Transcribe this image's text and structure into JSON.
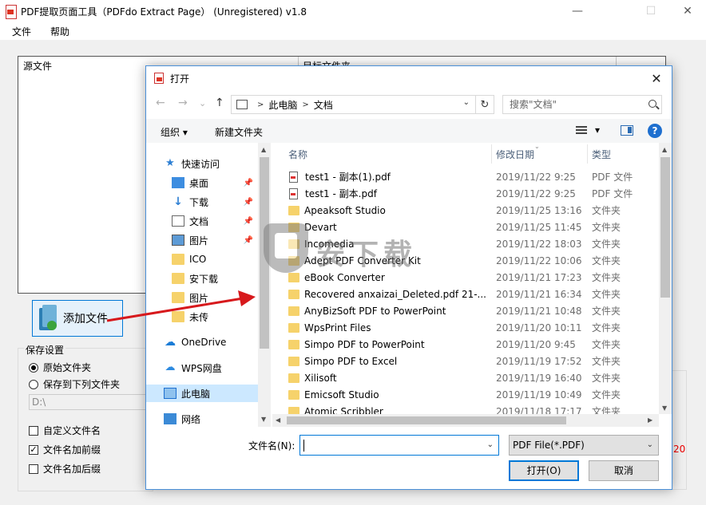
{
  "app": {
    "title": "PDF提取页面工具（PDFdo Extract Page） (Unregistered) v1.8",
    "window_controls": {
      "minimize": "—",
      "maximize": "☐",
      "close": "✕"
    },
    "menu": [
      "文件",
      "帮助"
    ],
    "source_panel": {
      "source_header": "源文件",
      "target_header": "目标文件夹"
    },
    "add_file_label": "添加文件",
    "save_settings": {
      "title": "保存设置",
      "radio_original": "原始文件夹",
      "radio_save_to": "保存到下列文件夹",
      "path_value": "D:\\",
      "check_custom_name": "自定义文件名",
      "check_prefix": "文件名加前缀",
      "check_suffix": "文件名加后缀"
    },
    "red_number": "20"
  },
  "dialog": {
    "title": "打开",
    "close": "✕",
    "nav": {
      "back": "←",
      "forward": "→",
      "recent": "⌄",
      "up": "↑"
    },
    "breadcrumb": [
      "此电脑",
      "文档"
    ],
    "search_placeholder": "搜索\"文档\"",
    "toolbar": {
      "organize": "组织 ▾",
      "new_folder": "新建文件夹",
      "view_dropdown": "▾",
      "help": "?"
    },
    "nav_pane": [
      {
        "label": "快速访问",
        "icon": "star-icon",
        "pinned": false
      },
      {
        "label": "桌面",
        "icon": "desktop-icon",
        "pinned": true
      },
      {
        "label": "下载",
        "icon": "download-icon",
        "pinned": true
      },
      {
        "label": "文档",
        "icon": "document-icon",
        "pinned": true
      },
      {
        "label": "图片",
        "icon": "pictures-icon",
        "pinned": true
      },
      {
        "label": "ICO",
        "icon": "folder-icon",
        "pinned": false
      },
      {
        "label": "安下载",
        "icon": "folder-icon",
        "pinned": false
      },
      {
        "label": "图片",
        "icon": "folder-icon",
        "pinned": false
      },
      {
        "label": "未传",
        "icon": "folder-icon",
        "pinned": false
      },
      {
        "label": "OneDrive",
        "icon": "cloud-icon",
        "pinned": false
      },
      {
        "label": "WPS网盘",
        "icon": "wps-cloud-icon",
        "pinned": false
      },
      {
        "label": "此电脑",
        "icon": "computer-icon",
        "pinned": false,
        "selected": true
      },
      {
        "label": "网络",
        "icon": "network-icon",
        "pinned": false
      }
    ],
    "columns": {
      "name": "名称",
      "date": "修改日期",
      "type": "类型"
    },
    "files": [
      {
        "name": "test1 - 副本(1).pdf",
        "date": "2019/11/22 9:25",
        "type": "PDF 文件",
        "kind": "pdf"
      },
      {
        "name": "test1 - 副本.pdf",
        "date": "2019/11/22 9:25",
        "type": "PDF 文件",
        "kind": "pdf"
      },
      {
        "name": "Apeaksoft Studio",
        "date": "2019/11/25 13:16",
        "type": "文件夹",
        "kind": "folder"
      },
      {
        "name": "Devart",
        "date": "2019/11/25 11:45",
        "type": "文件夹",
        "kind": "folder"
      },
      {
        "name": "Incomedia",
        "date": "2019/11/22 18:03",
        "type": "文件夹",
        "kind": "folder"
      },
      {
        "name": "Adept PDF Converter Kit",
        "date": "2019/11/22 10:06",
        "type": "文件夹",
        "kind": "folder"
      },
      {
        "name": "eBook Converter",
        "date": "2019/11/21 17:23",
        "type": "文件夹",
        "kind": "folder"
      },
      {
        "name": "Recovered anxaizai_Deleted.pdf 21-...",
        "date": "2019/11/21 16:34",
        "type": "文件夹",
        "kind": "folder"
      },
      {
        "name": "AnyBizSoft PDF to PowerPoint",
        "date": "2019/11/21 10:48",
        "type": "文件夹",
        "kind": "folder"
      },
      {
        "name": "WpsPrint Files",
        "date": "2019/11/20 10:11",
        "type": "文件夹",
        "kind": "folder"
      },
      {
        "name": "Simpo PDF to PowerPoint",
        "date": "2019/11/20 9:45",
        "type": "文件夹",
        "kind": "folder"
      },
      {
        "name": "Simpo PDF to Excel",
        "date": "2019/11/19 17:52",
        "type": "文件夹",
        "kind": "folder"
      },
      {
        "name": "Xilisoft",
        "date": "2019/11/19 16:40",
        "type": "文件夹",
        "kind": "folder"
      },
      {
        "name": "Emicsoft Studio",
        "date": "2019/11/19 10:49",
        "type": "文件夹",
        "kind": "folder"
      },
      {
        "name": "Atomic Scribbler",
        "date": "2019/11/18 17:17",
        "type": "文件夹",
        "kind": "folder"
      }
    ],
    "filename_label": "文件名(N):",
    "filename_value": "",
    "file_type": "PDF File(*.PDF)",
    "open_button": "打开(O)",
    "cancel_button": "取消"
  },
  "watermark": {
    "text": "安下载"
  },
  "colors": {
    "accent": "#0078d7",
    "selection": "#cce8ff",
    "folder": "#f6d26b",
    "arrow": "#d7191c"
  }
}
